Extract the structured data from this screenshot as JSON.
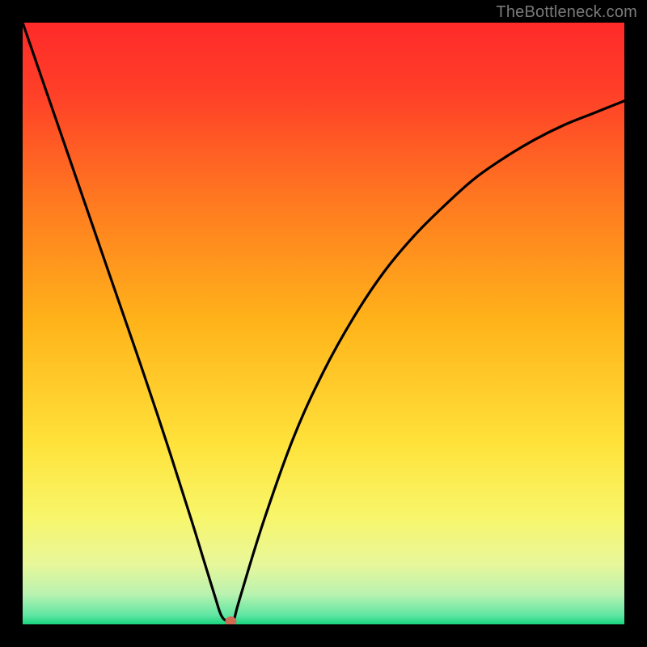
{
  "watermark": "TheBottleneck.com",
  "chart_data": {
    "type": "line",
    "title": "",
    "xlabel": "",
    "ylabel": "",
    "xlim": [
      0,
      100
    ],
    "ylim": [
      0,
      100
    ],
    "grid": false,
    "legend": false,
    "background": {
      "stops": [
        {
          "offset": 0.0,
          "color": "#ff2a2a"
        },
        {
          "offset": 0.12,
          "color": "#ff4028"
        },
        {
          "offset": 0.3,
          "color": "#ff7a20"
        },
        {
          "offset": 0.5,
          "color": "#ffb41a"
        },
        {
          "offset": 0.7,
          "color": "#ffe23a"
        },
        {
          "offset": 0.82,
          "color": "#f8f66a"
        },
        {
          "offset": 0.9,
          "color": "#e8f79a"
        },
        {
          "offset": 0.95,
          "color": "#b9f2b0"
        },
        {
          "offset": 0.985,
          "color": "#5fe6a2"
        },
        {
          "offset": 1.0,
          "color": "#18d47e"
        }
      ]
    },
    "series": [
      {
        "name": "bottleneck-curve",
        "color": "#000000",
        "x": [
          0,
          5,
          10,
          15,
          20,
          24,
          28,
          30,
          32,
          33,
          34,
          35,
          36,
          40,
          45,
          50,
          55,
          60,
          65,
          70,
          75,
          80,
          85,
          90,
          95,
          100
        ],
        "y": [
          100,
          85.5,
          71,
          56.5,
          42,
          30,
          17.5,
          11,
          4.5,
          1.5,
          0.5,
          0.5,
          4,
          17,
          31,
          42,
          51,
          58.5,
          64.5,
          69.5,
          74,
          77.5,
          80.5,
          83,
          85,
          87
        ]
      }
    ],
    "marker": {
      "name": "optimum-point",
      "x": 34.6,
      "y": 0.5,
      "color": "#d16a55"
    },
    "frame": {
      "stroke": "#000000",
      "strokeWidth": 28
    }
  }
}
